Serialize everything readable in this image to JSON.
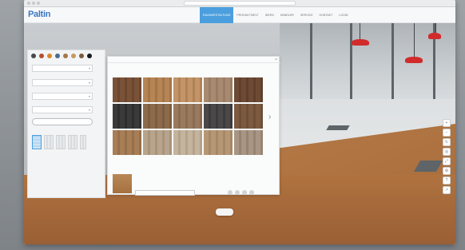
{
  "app": {
    "logo": "Paltin"
  },
  "nav": {
    "tabs": [
      {
        "label": "Raumgestaltung",
        "active": true
      },
      {
        "label": "Produktwelt",
        "active": false
      },
      {
        "label": "Ideen",
        "active": false
      },
      {
        "label": "Händler",
        "active": false
      },
      {
        "label": "Service",
        "active": false
      },
      {
        "label": "Kontakt",
        "active": false
      },
      {
        "label": "Login",
        "active": false
      }
    ]
  },
  "left_panel": {
    "colors": [
      "#4a4a4a",
      "#b84d2f",
      "#d9882b",
      "#4b6b8a",
      "#a8774a",
      "#c29b6a",
      "#7d5b3e",
      "#1a1a1a"
    ],
    "selects": [
      "",
      "",
      "",
      ""
    ],
    "button_label": "",
    "sublabel": ""
  },
  "modal": {
    "title": "",
    "page_label": "",
    "current_label": "",
    "current_name": "",
    "field_placeholder": "",
    "rotation_label": "",
    "tiles": [
      {
        "color_a": "#7a5238",
        "color_b": "#6b4630"
      },
      {
        "color_a": "#b58556",
        "color_b": "#a57447"
      },
      {
        "color_a": "#c29467",
        "color_b": "#b08256"
      },
      {
        "color_a": "#a88a72",
        "color_b": "#9a7c63"
      },
      {
        "color_a": "#6d4a34",
        "color_b": "#5f3f2c"
      },
      {
        "color_a": "#3a3a3a",
        "color_b": "#2e2e2e"
      },
      {
        "color_a": "#8c6a4b",
        "color_b": "#7d5d40"
      },
      {
        "color_a": "#9a7a5f",
        "color_b": "#8b6c52"
      },
      {
        "color_a": "#4a4848",
        "color_b": "#3d3b3b"
      },
      {
        "color_a": "#7c5a3f",
        "color_b": "#6d4e36"
      },
      {
        "color_a": "#a87e57",
        "color_b": "#966f4b"
      },
      {
        "color_a": "#b8a48c",
        "color_b": "#a8937b"
      },
      {
        "color_a": "#c4b39d",
        "color_b": "#b4a28a"
      },
      {
        "color_a": "#b69775",
        "color_b": "#a68766"
      },
      {
        "color_a": "#a89583",
        "color_b": "#978373"
      }
    ]
  },
  "scene": {
    "badge": ""
  }
}
